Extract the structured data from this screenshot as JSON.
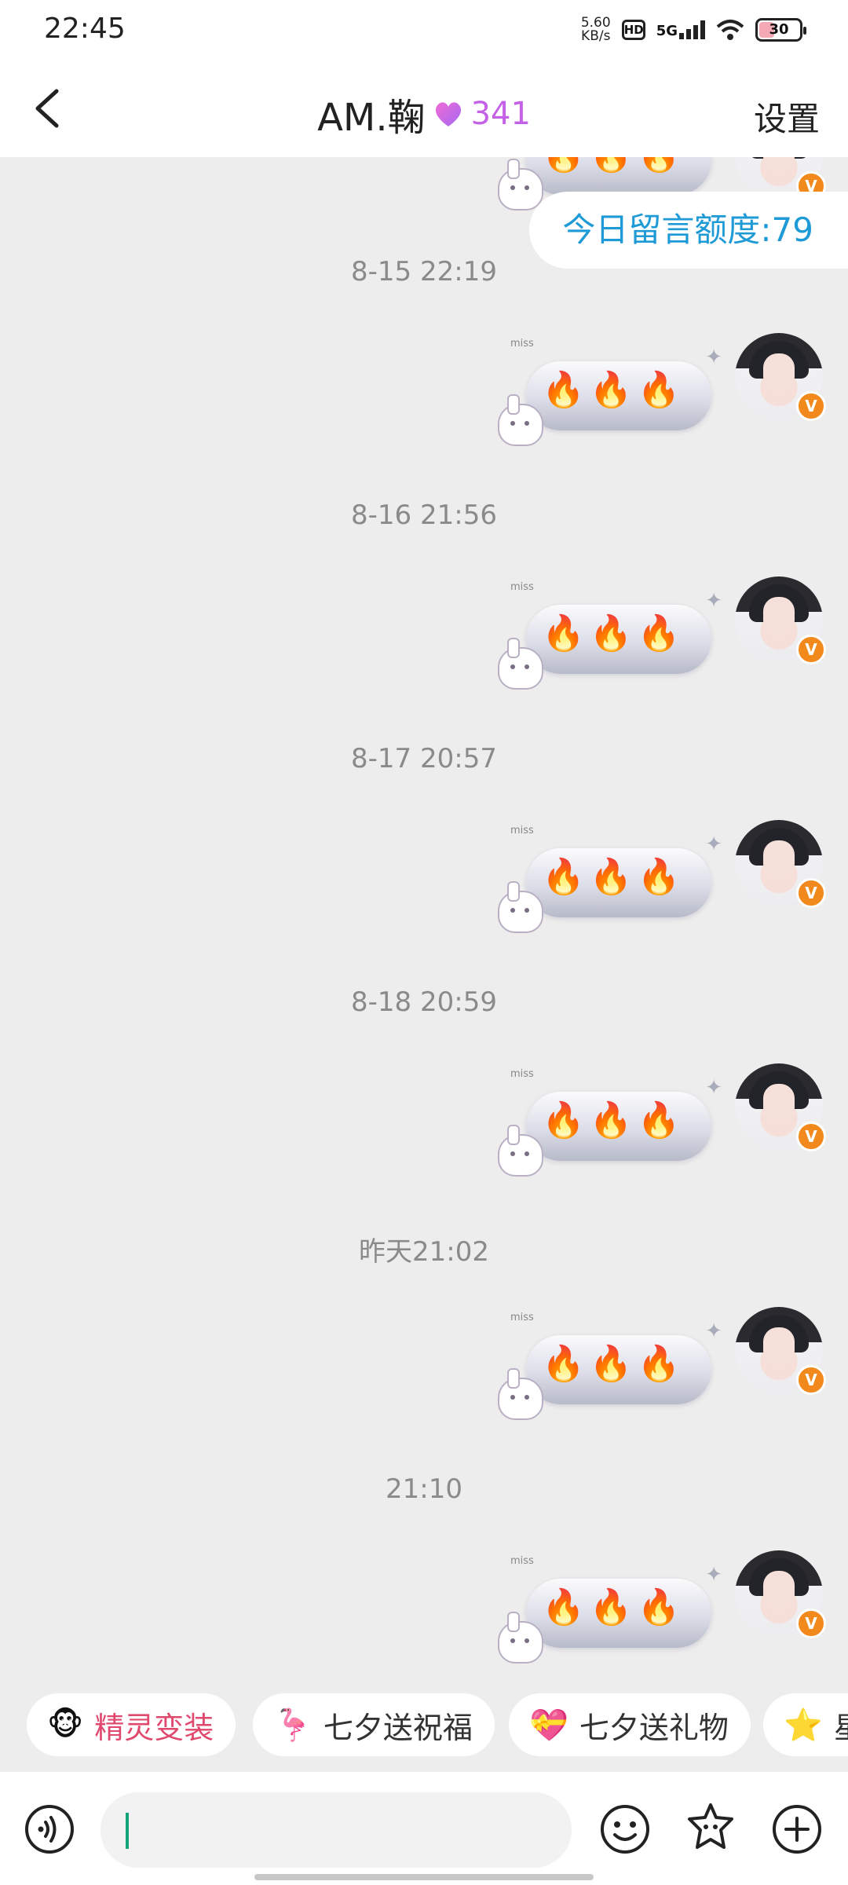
{
  "status_bar": {
    "time": "22:45",
    "net_speed_value": "5.60",
    "net_speed_unit": "KB/s",
    "hd_label": "HD",
    "network": "5G",
    "battery": "30"
  },
  "header": {
    "back_icon": "chevron-left",
    "title": "AM.鞠",
    "intimacy_icon": "purple-heart",
    "intimacy_value": "341",
    "settings_label": "设置"
  },
  "chat": {
    "quota_label": "今日留言额度:79",
    "messages": [
      {
        "timestamp": "8-15 22:19",
        "sticker": "🔥🔥🔥",
        "sticker_text": "miss"
      },
      {
        "timestamp": "8-16 21:56",
        "sticker": "🔥🔥🔥",
        "sticker_text": "miss"
      },
      {
        "timestamp": "8-17 20:57",
        "sticker": "🔥🔥🔥",
        "sticker_text": "miss"
      },
      {
        "timestamp": "8-18 20:59",
        "sticker": "🔥🔥🔥",
        "sticker_text": "miss"
      },
      {
        "timestamp": "昨天21:02",
        "sticker": "🔥🔥🔥",
        "sticker_text": "miss"
      },
      {
        "timestamp": "21:10",
        "sticker": "🔥🔥🔥",
        "sticker_text": "miss"
      }
    ],
    "top_partial_sticker": "🔥🔥🔥",
    "avatar_badge": "V"
  },
  "quick_chips": [
    {
      "icon": "🐵",
      "label": "精灵变装"
    },
    {
      "icon": "🦩",
      "label": "七夕送祝福"
    },
    {
      "icon": "💝",
      "label": "七夕送礼物"
    },
    {
      "icon": "⭐",
      "label": "星"
    }
  ],
  "input_bar": {
    "voice_icon": "voice-icon",
    "input_value": "",
    "emoji_icon": "smiley-icon",
    "sticker_icon": "star-face-icon",
    "plus_icon": "plus-icon"
  }
}
